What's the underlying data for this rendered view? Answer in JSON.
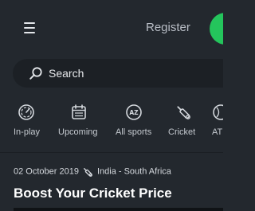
{
  "header": {
    "register_label": "Register"
  },
  "search": {
    "placeholder": "Search"
  },
  "sports_nav": {
    "items": [
      {
        "label": "In-play",
        "icon": "in-play-gauge-icon"
      },
      {
        "label": "Upcoming",
        "icon": "calendar-icon"
      },
      {
        "label": "All sports",
        "icon": "a-z-icon"
      },
      {
        "label": "Cricket",
        "icon": "cricket-bat-icon"
      },
      {
        "label": "AT",
        "icon": "partial-sport-icon"
      }
    ]
  },
  "event": {
    "date": "02 October 2019",
    "teams": "India - South Africa",
    "sport_icon": "cricket-bat-icon"
  },
  "promo": {
    "title": "Boost Your Cricket Price"
  },
  "colors": {
    "background": "#23282e",
    "search_bg": "#1c2025",
    "accent_green": "#24c55c",
    "muted_text": "#b9bec6"
  }
}
